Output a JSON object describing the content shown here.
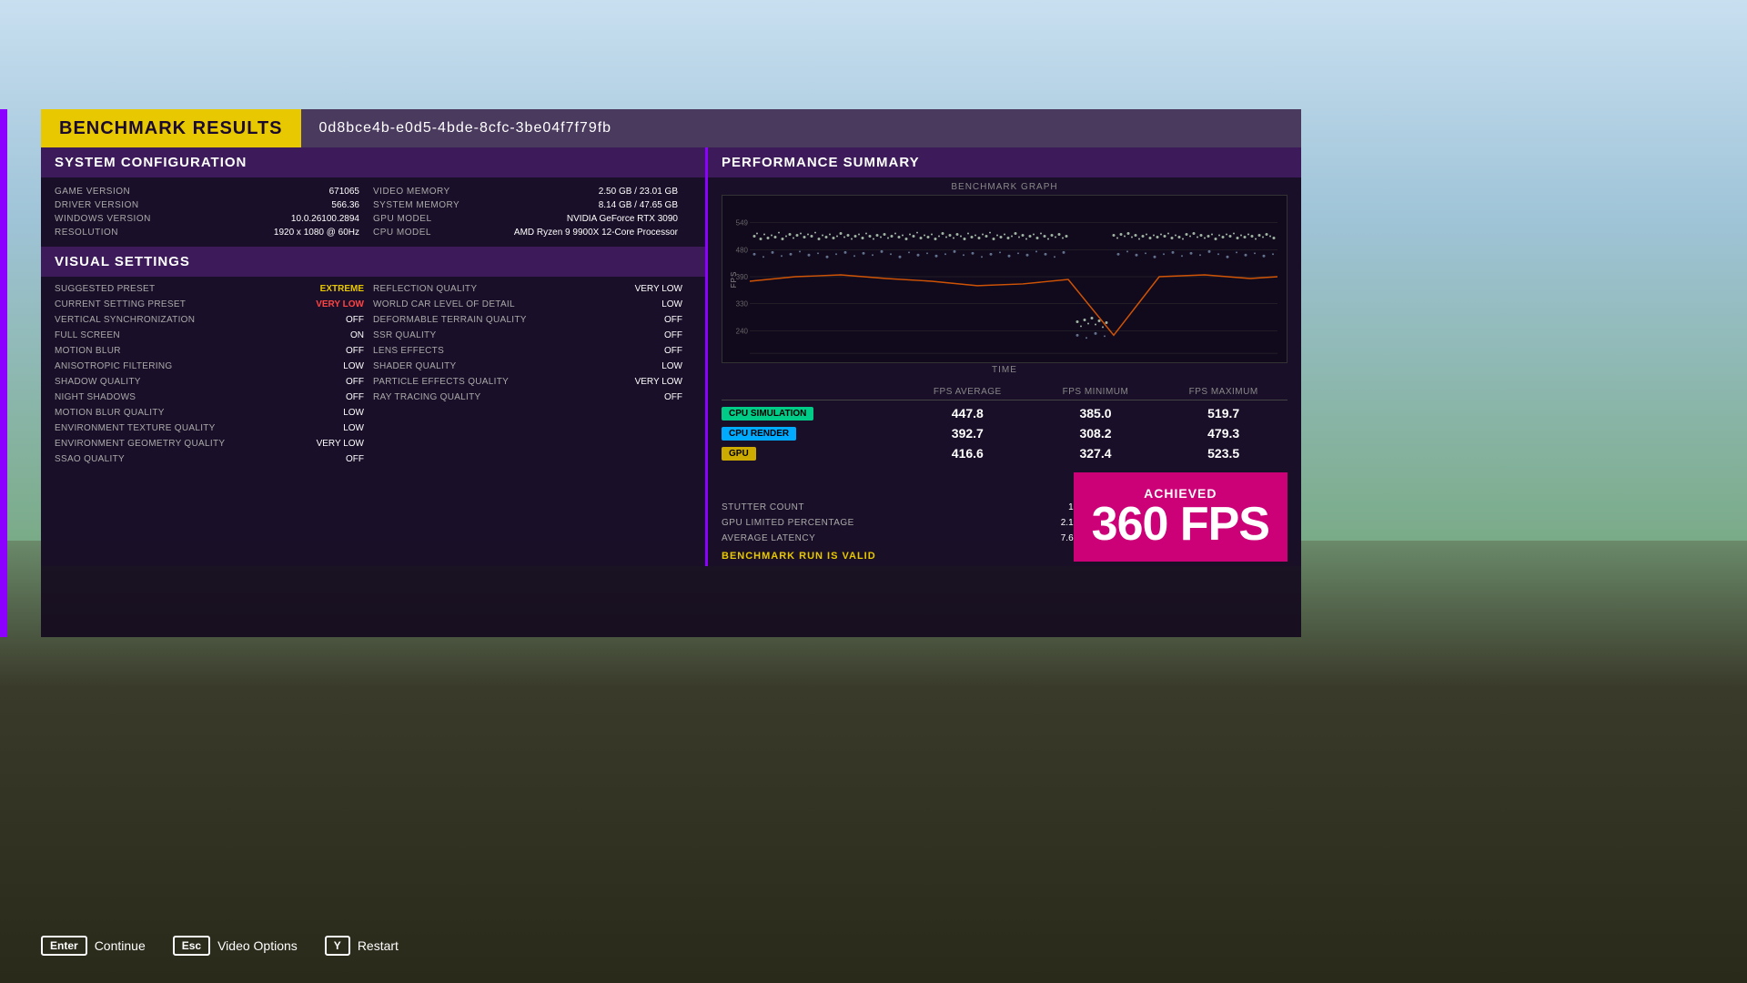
{
  "title": {
    "benchmark_label": "BENCHMARK RESULTS",
    "run_id": "0d8bce4b-e0d5-4bde-8cfc-3be04f7f79fb"
  },
  "system_config": {
    "section_title": "SYSTEM CONFIGURATION",
    "items_left": [
      {
        "label": "GAME VERSION",
        "value": "671065"
      },
      {
        "label": "DRIVER VERSION",
        "value": "566.36"
      },
      {
        "label": "WINDOWS VERSION",
        "value": "10.0.26100.2894"
      },
      {
        "label": "RESOLUTION",
        "value": "1920 x 1080 @ 60Hz"
      }
    ],
    "items_right": [
      {
        "label": "VIDEO MEMORY",
        "value": "2.50 GB / 23.01 GB"
      },
      {
        "label": "SYSTEM MEMORY",
        "value": "8.14 GB / 47.65 GB"
      },
      {
        "label": "GPU MODEL",
        "value": "NVIDIA GeForce RTX 3090"
      },
      {
        "label": "CPU MODEL",
        "value": "AMD Ryzen 9 9900X 12-Core Processor"
      }
    ]
  },
  "visual_settings": {
    "section_title": "VISUAL SETTINGS",
    "items_left": [
      {
        "label": "SUGGESTED PRESET",
        "value": "EXTREME",
        "style": "yellow"
      },
      {
        "label": "CURRENT SETTING PRESET",
        "value": "VERY LOW",
        "style": "red"
      },
      {
        "label": "VERTICAL SYNCHRONIZATION",
        "value": "OFF"
      },
      {
        "label": "FULL SCREEN",
        "value": "ON"
      },
      {
        "label": "MOTION BLUR",
        "value": "OFF"
      },
      {
        "label": "ANISOTROPIC FILTERING",
        "value": "LOW"
      },
      {
        "label": "SHADOW QUALITY",
        "value": "OFF"
      },
      {
        "label": "NIGHT SHADOWS",
        "value": "OFF"
      },
      {
        "label": "MOTION BLUR QUALITY",
        "value": "LOW"
      },
      {
        "label": "ENVIRONMENT TEXTURE QUALITY",
        "value": "LOW"
      },
      {
        "label": "ENVIRONMENT GEOMETRY QUALITY",
        "value": "VERY LOW"
      },
      {
        "label": "SSAO QUALITY",
        "value": "OFF"
      }
    ],
    "items_right": [
      {
        "label": "REFLECTION QUALITY",
        "value": "VERY LOW"
      },
      {
        "label": "WORLD CAR LEVEL OF DETAIL",
        "value": "LOW"
      },
      {
        "label": "DEFORMABLE TERRAIN QUALITY",
        "value": "OFF"
      },
      {
        "label": "SSR QUALITY",
        "value": "OFF"
      },
      {
        "label": "LENS EFFECTS",
        "value": "OFF"
      },
      {
        "label": "SHADER QUALITY",
        "value": "LOW"
      },
      {
        "label": "PARTICLE EFFECTS QUALITY",
        "value": "VERY LOW"
      },
      {
        "label": "RAY TRACING QUALITY",
        "value": "OFF"
      }
    ]
  },
  "performance": {
    "section_title": "PERFORMANCE SUMMARY",
    "graph_title": "BENCHMARK GRAPH",
    "time_label": "TIME",
    "fps_label": "FPS",
    "col_headers": [
      "",
      "FPS AVERAGE",
      "FPS MINIMUM",
      "FPS MAXIMUM"
    ],
    "rows": [
      {
        "label": "CPU SIMULATION",
        "badge_class": "badge-green",
        "avg": "447.8",
        "min": "385.0",
        "max": "519.7"
      },
      {
        "label": "CPU RENDER",
        "badge_class": "badge-cyan",
        "avg": "392.7",
        "min": "308.2",
        "max": "479.3"
      },
      {
        "label": "GPU",
        "badge_class": "badge-yellow",
        "avg": "416.6",
        "min": "327.4",
        "max": "523.5"
      }
    ],
    "stutter_count_label": "STUTTER COUNT",
    "stutter_count_value": "1",
    "gpu_limited_label": "GPU LIMITED PERCENTAGE",
    "gpu_limited_value": "2.1",
    "avg_latency_label": "AVERAGE LATENCY",
    "avg_latency_value": "7.6",
    "benchmark_valid_label": "BENCHMARK RUN IS VALID",
    "achieved_label": "ACHIEVED",
    "achieved_fps": "360 FPS"
  },
  "controls": [
    {
      "key": "Enter",
      "label": "Continue"
    },
    {
      "key": "Esc",
      "label": "Video Options"
    },
    {
      "key": "Y",
      "label": "Restart"
    }
  ]
}
